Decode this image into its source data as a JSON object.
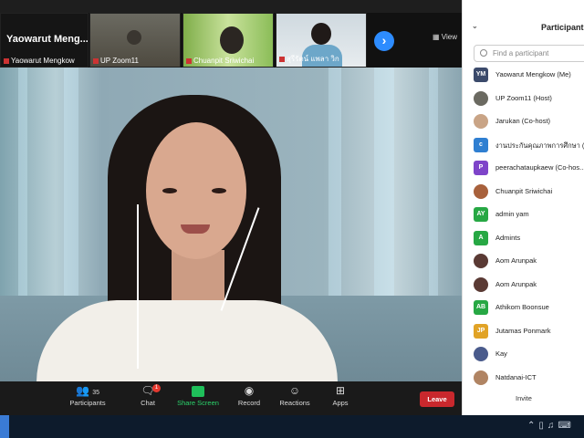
{
  "gallery": {
    "tiles": [
      {
        "name": "Yaowarut Mengkow",
        "big_name": "Yaowarut Meng..."
      },
      {
        "name": "UP Zoom11"
      },
      {
        "name": "Chuanpit Sriwichai"
      },
      {
        "name": "สุรีรัตน์ แพลา วิก"
      }
    ],
    "next_glyph": "›",
    "view_label": "View"
  },
  "toolbar": {
    "participants_label": "Participants",
    "participants_count": "35",
    "chat_label": "Chat",
    "chat_badge": "1",
    "share_label": "Share Screen",
    "record_label": "Record",
    "reactions_label": "Reactions",
    "apps_label": "Apps",
    "leave_label": "Leave"
  },
  "panel": {
    "title": "Participants",
    "search_placeholder": "Find a participant",
    "invite_label": "Invite",
    "participants": [
      {
        "initials": "YM",
        "color": "#3b4a6b",
        "name": "Yaowarut Mengkow (Me)"
      },
      {
        "initials": "",
        "color": "#6b6a61",
        "name": "UP Zoom11 (Host)"
      },
      {
        "initials": "",
        "color": "#c9a486",
        "name": "Jarukan (Co-host)"
      },
      {
        "initials": "c",
        "color": "#2f7fd1",
        "name": "งานประกันคุณภาพการศึกษา (Co..."
      },
      {
        "initials": "P",
        "color": "#7e44c9",
        "name": "peerachataupkaew (Co-hos..."
      },
      {
        "initials": "",
        "color": "#a8613c",
        "name": "Chuanpit Sriwichai"
      },
      {
        "initials": "AY",
        "color": "#27a844",
        "name": "admin yam"
      },
      {
        "initials": "A",
        "color": "#27a844",
        "name": "Admints"
      },
      {
        "initials": "",
        "color": "#5a3a34",
        "name": "Aom Arunpak"
      },
      {
        "initials": "",
        "color": "#5a3a34",
        "name": "Aom Arunpak"
      },
      {
        "initials": "AB",
        "color": "#27a844",
        "name": "Athikom Boonsue"
      },
      {
        "initials": "JP",
        "color": "#e1a326",
        "name": "Jutamas Ponmark"
      },
      {
        "initials": "",
        "color": "#4a5b8c",
        "name": "Kay"
      },
      {
        "initials": "",
        "color": "#b08463",
        "name": "Natdanai-ICT"
      }
    ]
  }
}
